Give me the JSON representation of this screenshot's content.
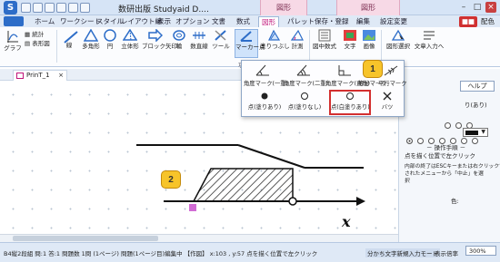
{
  "window": {
    "title": "数研出版 Studyaid D....",
    "context_tab_1": "図形",
    "context_tab_2": "図形"
  },
  "tabs": [
    "ホーム",
    "ワークシート",
    "スタイル",
    "レイアウト編",
    "表示",
    "オプション",
    "文書",
    "数式",
    "図形",
    "パレット",
    "保存・登録",
    "編集",
    "設定変更"
  ],
  "active_tab": "図形",
  "tab_right": {
    "badge": "■■",
    "help": "配色"
  },
  "ribbon": {
    "buttons": [
      "グラフ",
      "線",
      "多角形",
      "円",
      "立体形",
      "ブロック矢印",
      "輪",
      "数直線",
      "ツール",
      "マーカー点",
      "塗りつぶし",
      "計測",
      "図中数式",
      "文字",
      "画像",
      "図形選択",
      "文章入力へ"
    ],
    "small_buttons": [
      "統計",
      "表形図"
    ],
    "group_label": "項目"
  },
  "doc_tab": {
    "name": "PrinT_1",
    "close": "×"
  },
  "dropdown": {
    "row1": [
      "角度マーク(一重)",
      "角度マーク(二重)",
      "角度マーク(直角)",
      "等分マーク",
      "平行マーク"
    ],
    "row2": [
      "点(塗りあり)",
      "点(塗りなし)",
      "点(白塗りあり)",
      "バツ"
    ],
    "highlighted": "点(白塗りあり)"
  },
  "callouts": [
    "1",
    "2"
  ],
  "canvas": {
    "axis_label": "x"
  },
  "right_panel": {
    "help_button": "ヘルプ",
    "line1": "り(あり)",
    "color_label": "色:",
    "steps_heading": "－ 操作手順 －",
    "step1": "点を描く位置で左クリック",
    "note1": "内部の終了はESCキーまたは右クリックで表示",
    "note2": "されたメニューから「中止」を選",
    "note3": "択"
  },
  "status": {
    "left": "B4縦2段組 問:1 答:1 問題数 1問 (1ページ) 問題(1ページ目)編集中 【作図】 x:103 , y:57 点を描く位置で左クリック",
    "mode": "分かち文字新規入力モード",
    "zoom_label": "表示倍率",
    "zoom": "300%"
  },
  "colors": {
    "accent": "#c0157a",
    "highlight": "#d32f2f",
    "callout": "#f7c42a",
    "marker": "#d16bd4"
  }
}
